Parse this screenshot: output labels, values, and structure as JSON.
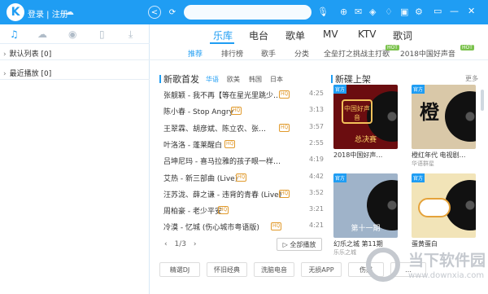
{
  "header": {
    "logo_letter": "K",
    "login_text": "登录 | 注册",
    "back_label": "<",
    "refresh_label": "⟳",
    "search_placeholder": ""
  },
  "sidebar": {
    "tab_icons": [
      "music-note-icon",
      "cloud-icon",
      "radio-icon",
      "device-icon",
      "download-icon"
    ],
    "playlists": [
      {
        "label": "默认列表",
        "count": "[0]"
      },
      {
        "label": "最近播放",
        "count": "[0]"
      }
    ]
  },
  "main_tabs": [
    "乐库",
    "电台",
    "歌单",
    "MV",
    "KTV",
    "歌词"
  ],
  "sub_tabs": [
    "推荐",
    "排行榜",
    "歌手",
    "分类",
    "全垒打之挑战主打歌",
    "2018中国好声音"
  ],
  "new_songs": {
    "title": "新歌首发",
    "filters": [
      "华语",
      "欧美",
      "韩国",
      "日本"
    ],
    "songs": [
      {
        "title": "张靓颖 - 我不再【等在星光里跳少…",
        "tag": "HQ",
        "time": "4:25"
      },
      {
        "title": "陈小春 - Stop Angry",
        "tag": "HQ",
        "time": "3:13"
      },
      {
        "title": "王翠霖、胡彦斌、陈立农、张…",
        "tag": "HQ",
        "time": "3:57"
      },
      {
        "title": "叶洛洛 - 蓬莱醒白",
        "tag": "HQ",
        "time": "2:55"
      },
      {
        "title": "吕坤尼玛 - 喜马拉雅的孩子眼一样…",
        "tag": "HQ",
        "time": "4:19"
      },
      {
        "title": "艾热 - 新三部曲 (Live)",
        "tag": "HQ",
        "time": "4:42"
      },
      {
        "title": "汪苏泷、薛之谦 - 违背的青春 (Live)",
        "tag": "HQ",
        "time": "3:52"
      },
      {
        "title": "周柏豪 - 老少平安",
        "tag": "HQ",
        "time": "3:21"
      },
      {
        "title": "冷漠 - 忆城 (伤心城市粤语版)",
        "tag": "HQ",
        "time": "4:21"
      }
    ],
    "pager": "1/3",
    "play_all": "▷ 全部播放"
  },
  "new_albums": {
    "title": "新碟上架",
    "more": "更多",
    "albums": [
      {
        "badge": "官方",
        "cover_text": "总决赛",
        "name": "2018中国好声…",
        "sub": ""
      },
      {
        "badge": "官方",
        "cover_text": "",
        "name": "橙红年代 电视剧…",
        "sub": "华语群星"
      },
      {
        "badge": "官方",
        "cover_text": "第十一期",
        "name": "幻乐之城 第11期",
        "sub": "乐乐之城"
      },
      {
        "badge": "官方",
        "cover_text": "",
        "name": "蛋黄蛋白",
        "sub": ""
      }
    ]
  },
  "bottom_tags": [
    "精選DJ",
    "怀旧经典",
    "洗脑电音",
    "无损APP",
    "伤感",
    "…"
  ],
  "watermark": {
    "name": "当下软件园",
    "url": "www.downxia.com"
  }
}
